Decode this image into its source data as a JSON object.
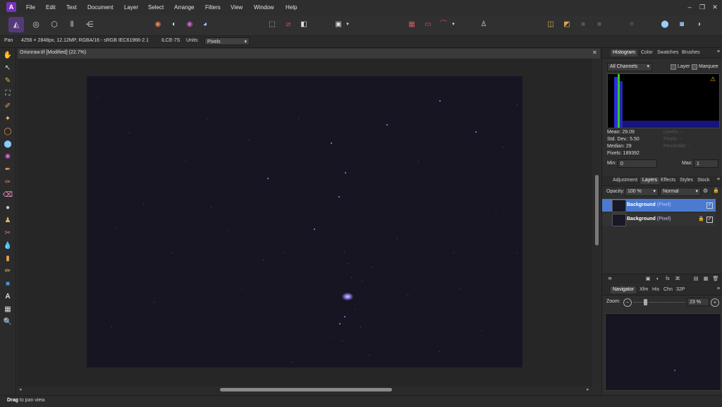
{
  "app": {
    "logo_text": "A"
  },
  "menu": [
    "File",
    "Edit",
    "Text",
    "Document",
    "Layer",
    "Select",
    "Arrange",
    "Filters",
    "View",
    "Window",
    "Help"
  ],
  "window_controls": {
    "minimize": "–",
    "restore": "❐",
    "close": "✕"
  },
  "context": {
    "tool_name": "Pan",
    "doc_info": "4256 × 2848px, 12.12MP, RGBA/16 - sRGB IEC61966-2.1",
    "camera": "ILCE-7S",
    "units_label": "Units:",
    "units_value": "Pixels"
  },
  "document": {
    "tab_title": "Orionraw.tif [Modified] (22.7%)",
    "close_glyph": "✕"
  },
  "status": {
    "bold": "Drag",
    "text": " to pan view."
  },
  "histogram_panel": {
    "tabs": [
      "Histogram",
      "Color",
      "Swatches",
      "Brushes"
    ],
    "active_tab": "Histogram",
    "channel_select": "All Channels",
    "layer_label": "Layer",
    "marquee_label": "Marquee",
    "stats": {
      "mean": "Mean: 29.09",
      "std_dev": "Std. Dev.: 5.50",
      "median": "Median: 29",
      "pixels": "Pixels: 189392"
    },
    "dim_stats": {
      "levels": "Levels: -",
      "count": "Pixels: -",
      "percentile": "Percentile: -"
    },
    "min_label": "Min:",
    "min_value": "0",
    "max_label": "Max:",
    "max_value": "1",
    "warning_glyph": "⚠"
  },
  "layers_panel": {
    "tabs": [
      "Adjustment",
      "Layers",
      "Effects",
      "Styles",
      "Stock"
    ],
    "active_tab": "Layers",
    "opacity_label": "Opacity:",
    "opacity_value": "100 %",
    "blend_mode": "Normal",
    "layers": [
      {
        "name": "Background",
        "type": "(Pixel)",
        "selected": true,
        "locked": false
      },
      {
        "name": "Background",
        "type": "(Pixel)",
        "selected": false,
        "locked": true
      }
    ],
    "lock_glyph": "🔒",
    "check_glyph": "✓",
    "footer_icons": [
      "≋",
      "▣",
      "◐",
      "fx",
      "⌘",
      "▤",
      "▦",
      "🗑"
    ]
  },
  "navigator_panel": {
    "tabs": [
      "Navigator",
      "Xfm",
      "His",
      "Chn",
      "32P"
    ],
    "active_tab": "Navigator",
    "zoom_label": "Zoom:",
    "zoom_value": "23 %",
    "zoom_out_glyph": "−",
    "zoom_in_glyph": "+"
  },
  "panel_menu_glyph": "≡",
  "colors": {
    "accent": "#4a7bd0",
    "app_logo": "#7b2fbe",
    "image_bg": "#181523",
    "star": "#9a8cff",
    "histogram_blue": "#2d2dd8",
    "histogram_green": "#2ec72e"
  },
  "toolbar_icons": [
    "persona-photo-icon",
    "persona-liquify-icon",
    "persona-develop-icon",
    "persona-tone-mapping-icon",
    "persona-export-icon",
    "color-wheel-icon",
    "contrast-icon",
    "hsl-icon",
    "white-balance-icon",
    "marquee-icon",
    "deselect-icon",
    "invert-selection-icon",
    "mask-icon",
    "grid-icon",
    "align-icon",
    "snapping-icon",
    "assistant-icon",
    "arrange-front-icon",
    "arrange-forward-icon",
    "arrange-backward-icon",
    "arrange-back-icon",
    "text-icon",
    "boolean-add-icon",
    "boolean-subtract-icon",
    "boolean-intersect-icon"
  ],
  "tool_icons": [
    "✋",
    "↖",
    "✎",
    "⛶",
    "✐",
    "✦",
    "◯",
    "⬤",
    "✺",
    "✒",
    "✑",
    "⌫",
    "●",
    "♟",
    "✂",
    "💧",
    "▮",
    "✏",
    "■",
    "A",
    "▦",
    "🔍"
  ]
}
